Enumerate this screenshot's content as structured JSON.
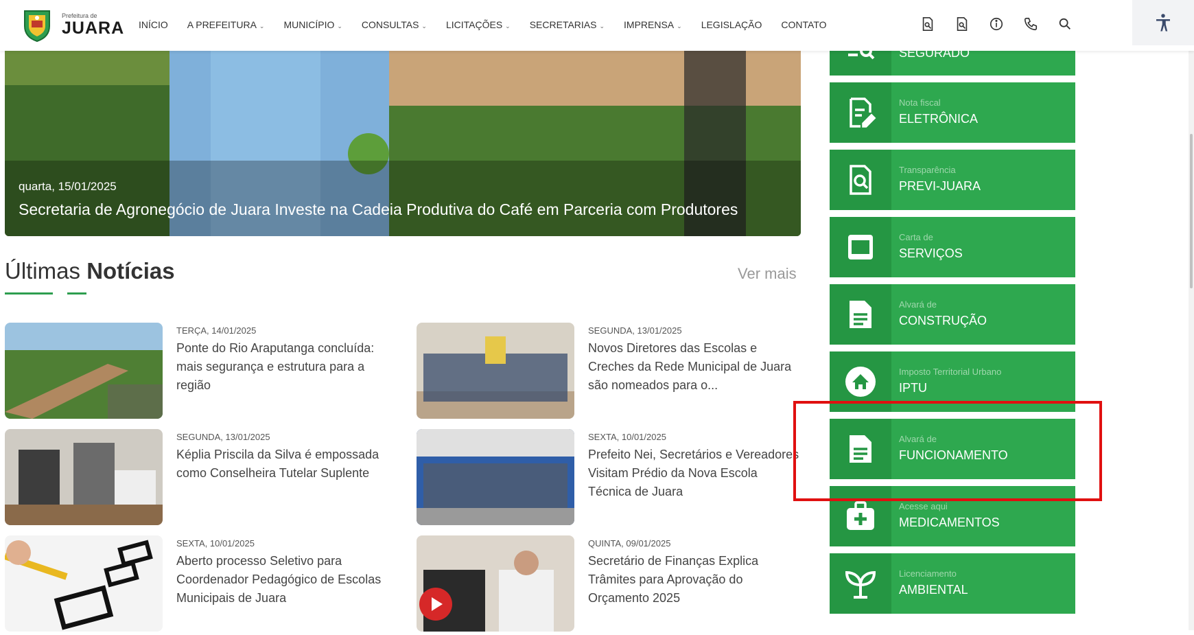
{
  "header": {
    "logo_small": "Prefeitura de",
    "logo_big": "JUARA",
    "nav": [
      {
        "label": "INÍCIO",
        "dropdown": false
      },
      {
        "label": "A PREFEITURA",
        "dropdown": true
      },
      {
        "label": "MUNICÍPIO",
        "dropdown": true
      },
      {
        "label": "CONSULTAS",
        "dropdown": true
      },
      {
        "label": "LICITAÇÕES",
        "dropdown": true
      },
      {
        "label": "SECRETARIAS",
        "dropdown": true
      },
      {
        "label": "IMPRENSA",
        "dropdown": true
      },
      {
        "label": "LEGISLAÇÃO",
        "dropdown": false
      },
      {
        "label": "CONTATO",
        "dropdown": false
      }
    ],
    "tools": [
      "document-search-icon",
      "document-search-icon",
      "info-icon",
      "phone-icon",
      "search-icon"
    ],
    "accessibility_icon": "accessibility-icon"
  },
  "hero": {
    "date": "quarta, 15/01/2025",
    "title": "Secretaria de Agronegócio de Juara Investe na Cadeia Produtiva do Café em Parceria com Produtores"
  },
  "news_section": {
    "title_light": "Últimas",
    "title_bold": "Notícias",
    "more": "Ver mais",
    "items": [
      {
        "date": "TERÇA, 14/01/2025",
        "title": "Ponte do Rio Araputanga concluída: mais segurança e estrutura para a região"
      },
      {
        "date": "SEGUNDA, 13/01/2025",
        "title": "Novos Diretores das Escolas e Creches da Rede Municipal de Juara são nomeados para o..."
      },
      {
        "date": "SEGUNDA, 13/01/2025",
        "title": "Képlia Priscila da Silva é empossada como Conselheira Tutelar Suplente"
      },
      {
        "date": "SEXTA, 10/01/2025",
        "title": "Prefeito Nei, Secretários e Vereadores Visitam Prédio da Nova Escola Técnica de Juara"
      },
      {
        "date": "SEXTA, 10/01/2025",
        "title": "Aberto processo Seletivo para Coordenador Pedagógico de Escolas Municipais de Juara"
      },
      {
        "date": "QUINTA, 09/01/2025",
        "title": "Secretário de Finanças Explica Trâmites para Aprovação do Orçamento 2025"
      }
    ]
  },
  "services": [
    {
      "small": "",
      "big": "SEGURADO",
      "icon": "search-list-icon"
    },
    {
      "small": "Nota fiscal",
      "big": "ELETRÔNICA",
      "icon": "edit-document-icon"
    },
    {
      "small": "Transparência",
      "big": "PREVI-JUARA",
      "icon": "document-search-icon"
    },
    {
      "small": "Carta de",
      "big": "SERVIÇOS",
      "icon": "window-icon"
    },
    {
      "small": "Alvará de",
      "big": "CONSTRUÇÃO",
      "icon": "document-icon"
    },
    {
      "small": "Imposto Territorial Urbano",
      "big": "IPTU",
      "icon": "home-icon"
    },
    {
      "small": "Alvará de",
      "big": "FUNCIONAMENTO",
      "icon": "document-icon"
    },
    {
      "small": "Acesse aqui",
      "big": "MEDICAMENTOS",
      "icon": "medical-kit-icon"
    },
    {
      "small": "Licenciamento",
      "big": "AMBIENTAL",
      "icon": "sprout-icon"
    }
  ],
  "colors": {
    "accent": "#2ea84f",
    "accent_dark": "#259643",
    "highlight": "#e01010"
  }
}
